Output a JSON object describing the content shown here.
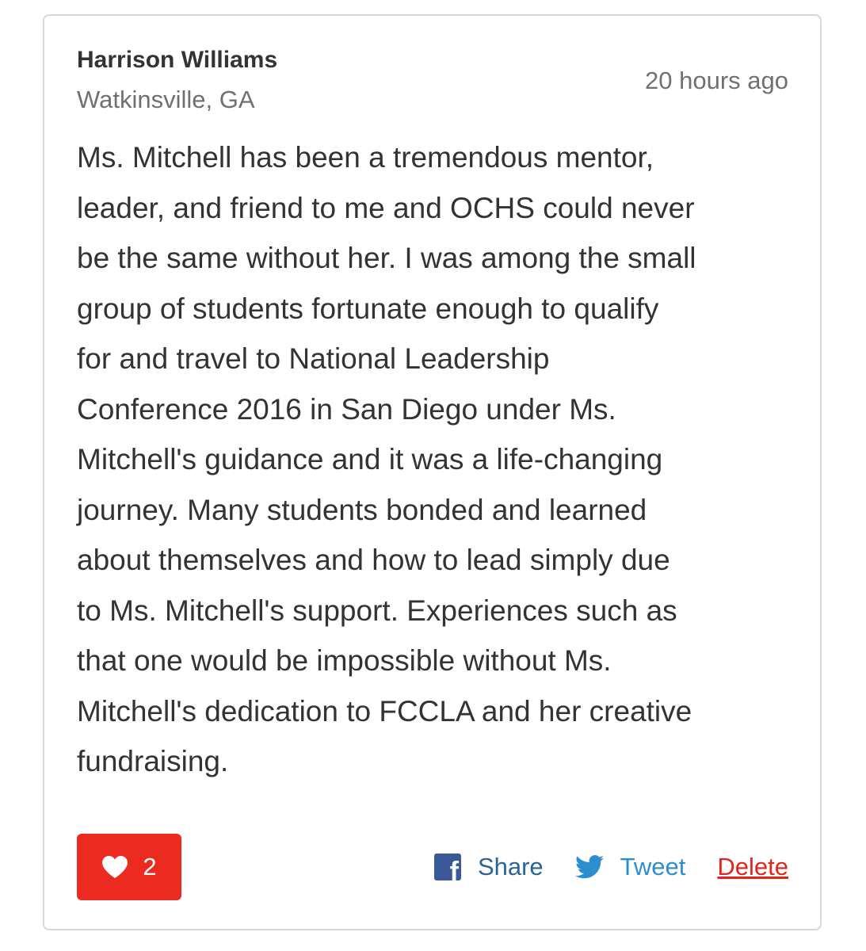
{
  "comment": {
    "author_name": "Harrison Williams",
    "author_location": "Watkinsville, GA",
    "timestamp": "20 hours ago",
    "body_lines": [
      "Ms. Mitchell has been a tremendous mentor,",
      "leader, and friend to me and OCHS could never",
      "be the same without her. I was among the small",
      "group of students fortunate enough to qualify",
      "for and travel to National Leadership",
      "Conference 2016 in San Diego under Ms.",
      "Mitchell's guidance and it was a life-changing",
      "journey. Many students bonded and learned",
      "about themselves and how to lead simply due",
      "to Ms. Mitchell's support. Experiences such as",
      "that one would be impossible without Ms.",
      "Mitchell's dedication to FCCLA and her creative",
      "fundraising."
    ]
  },
  "like_button": {
    "icon": "heart-icon",
    "count": "2",
    "color": "#ec2b20"
  },
  "actions": {
    "share_label": "Share",
    "share_icon": "facebook-icon",
    "tweet_label": "Tweet",
    "tweet_icon": "twitter-bird-icon",
    "delete_label": "Delete"
  },
  "colors": {
    "facebook": "#3b5998",
    "share_text": "#2a6496",
    "twitter": "#2d8ecf",
    "delete": "#e0261b"
  }
}
